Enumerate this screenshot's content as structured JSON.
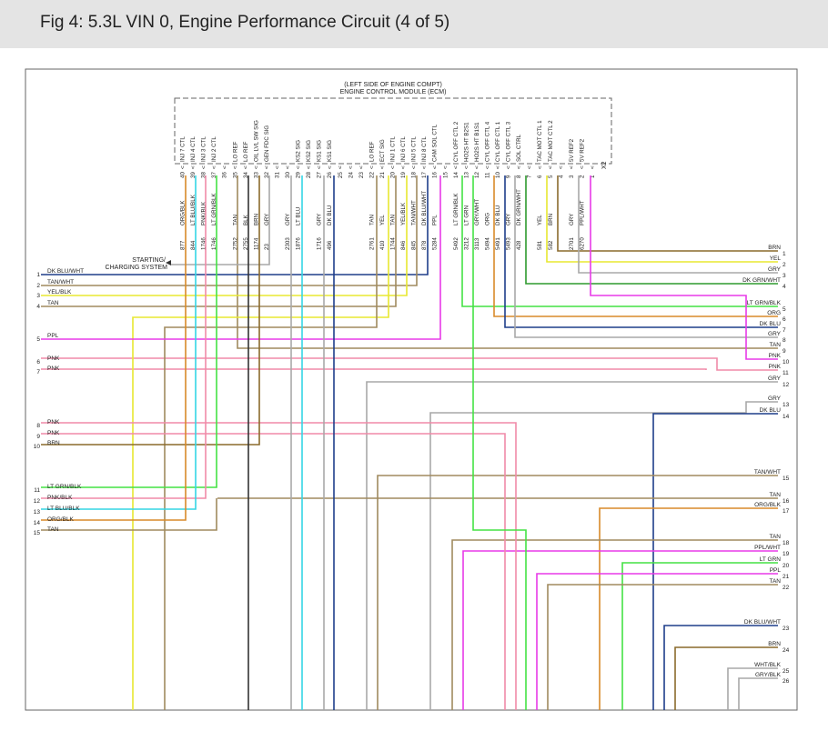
{
  "title": "Fig 4: 5.3L VIN 0, Engine Performance Circuit (4 of 5)",
  "ecm": {
    "line1": "(LEFT SIDE OF ENGINE COMPT)",
    "line2": "ENGINE CONTROL MODULE (ECM)",
    "connector": "X2",
    "pins": [
      {
        "pin": "40",
        "func": "INJ 7 CTL",
        "circuit": "877",
        "color": "ORG/BLK"
      },
      {
        "pin": "39",
        "func": "INJ 4 CTL",
        "circuit": "844",
        "color": "LT BLU/BLK"
      },
      {
        "pin": "38",
        "func": "INJ 3 CTL",
        "circuit": "1746",
        "color": "PNK/BLK"
      },
      {
        "pin": "37",
        "func": "INJ 2 CTL",
        "circuit": "1746",
        "color": "LT GRN/BLK"
      },
      {
        "pin": "36",
        "func": "",
        "circuit": "",
        "color": ""
      },
      {
        "pin": "35",
        "func": "LO REF",
        "circuit": "2752",
        "color": "TAN"
      },
      {
        "pin": "34",
        "func": "LO REF",
        "circuit": "2755",
        "color": "BLK"
      },
      {
        "pin": "33",
        "func": "OIL LVL SW SIG",
        "circuit": "1174",
        "color": "BRN"
      },
      {
        "pin": "32",
        "func": "GEN FDC SIG",
        "circuit": "23",
        "color": "GRY"
      },
      {
        "pin": "31",
        "func": "",
        "circuit": "",
        "color": ""
      },
      {
        "pin": "30",
        "func": "",
        "circuit": "2303",
        "color": "GRY"
      },
      {
        "pin": "29",
        "func": "KS2 SIG",
        "circuit": "1876",
        "color": "LT BLU"
      },
      {
        "pin": "28",
        "func": "KS2 SIG",
        "circuit": "",
        "color": ""
      },
      {
        "pin": "27",
        "func": "KS1 SIG",
        "circuit": "1716",
        "color": "GRY"
      },
      {
        "pin": "26",
        "func": "KS1 SIG",
        "circuit": "496",
        "color": "DK BLU"
      },
      {
        "pin": "25",
        "func": "",
        "circuit": "",
        "color": ""
      },
      {
        "pin": "24",
        "func": "",
        "circuit": "",
        "color": ""
      },
      {
        "pin": "23",
        "func": "",
        "circuit": "",
        "color": ""
      },
      {
        "pin": "22",
        "func": "LO REF",
        "circuit": "2761",
        "color": "TAN"
      },
      {
        "pin": "21",
        "func": "ECT SIG",
        "circuit": "410",
        "color": "YEL"
      },
      {
        "pin": "20",
        "func": "INJ 1 CTL",
        "circuit": "1744",
        "color": "TAN"
      },
      {
        "pin": "19",
        "func": "INJ 6 CTL",
        "circuit": "846",
        "color": "YEL/BLK"
      },
      {
        "pin": "18",
        "func": "INJ 5 CTL",
        "circuit": "845",
        "color": "TAN/WHT"
      },
      {
        "pin": "17",
        "func": "INJ 8 CTL",
        "circuit": "878",
        "color": "DK BLU/WHT"
      },
      {
        "pin": "16",
        "func": "CAM SOL CTL",
        "circuit": "5284",
        "color": "PPL"
      },
      {
        "pin": "15",
        "func": "",
        "circuit": "",
        "color": ""
      },
      {
        "pin": "14",
        "func": "CYL OFF CTL 2",
        "circuit": "5492",
        "color": "LT GRN/BLK"
      },
      {
        "pin": "13",
        "func": "HO2S HT B2S1",
        "circuit": "3212",
        "color": "LT GRN"
      },
      {
        "pin": "12",
        "func": "HO2S HT B1S1",
        "circuit": "3113",
        "color": "GRY/WHT"
      },
      {
        "pin": "11",
        "func": "CYL OFF CTL 4",
        "circuit": "5494",
        "color": "ORG"
      },
      {
        "pin": "10",
        "func": "CYL OFF CTL 1",
        "circuit": "5491",
        "color": "DK BLU"
      },
      {
        "pin": "9",
        "func": "CYL OFF CTL 3",
        "circuit": "5493",
        "color": "GRY"
      },
      {
        "pin": "8",
        "func": "SOL CTRL",
        "circuit": "428",
        "color": "DK GRN/WHT"
      },
      {
        "pin": "7",
        "func": "",
        "circuit": "",
        "color": ""
      },
      {
        "pin": "6",
        "func": "TAC MOT CTL 1",
        "circuit": "581",
        "color": "YEL"
      },
      {
        "pin": "5",
        "func": "TAC MOT CTL 2",
        "circuit": "582",
        "color": "BRN"
      },
      {
        "pin": "4",
        "func": "",
        "circuit": "",
        "color": ""
      },
      {
        "pin": "3",
        "func": "5V REF2",
        "circuit": "2701",
        "color": "GRY"
      },
      {
        "pin": "2",
        "func": "5V REF2",
        "circuit": "6270",
        "color": "PPL/WHT"
      },
      {
        "pin": "1",
        "func": "",
        "circuit": "",
        "color": ""
      }
    ]
  },
  "starting_label1": "STARTING/",
  "starting_label2": "CHARGING SYSTEM",
  "left_wires": [
    {
      "num": "1",
      "label": "DK BLU/WHT"
    },
    {
      "num": "2",
      "label": "TAN/WHT"
    },
    {
      "num": "3",
      "label": "YEL/BLK"
    },
    {
      "num": "4",
      "label": "TAN"
    },
    {
      "num": "5",
      "label": "PPL"
    },
    {
      "num": "6",
      "label": "PNK"
    },
    {
      "num": "7",
      "label": "PNK"
    },
    {
      "num": "8",
      "label": "PNK"
    },
    {
      "num": "9",
      "label": "PNK"
    },
    {
      "num": "10",
      "label": "BRN"
    },
    {
      "num": "11",
      "label": "LT GRN/BLK"
    },
    {
      "num": "12",
      "label": "PNK/BLK"
    },
    {
      "num": "13",
      "label": "LT BLU/BLK"
    },
    {
      "num": "14",
      "label": "ORG/BLK"
    },
    {
      "num": "15",
      "label": "TAN"
    }
  ],
  "right_wires": [
    {
      "num": "1",
      "label": "BRN"
    },
    {
      "num": "2",
      "label": "YEL"
    },
    {
      "num": "3",
      "label": "GRY"
    },
    {
      "num": "4",
      "label": "DK GRN/WHT"
    },
    {
      "num": "5",
      "label": "LT GRN/BLK"
    },
    {
      "num": "6",
      "label": "ORG"
    },
    {
      "num": "7",
      "label": "DK BLU"
    },
    {
      "num": "8",
      "label": "GRY"
    },
    {
      "num": "9",
      "label": "TAN"
    },
    {
      "num": "10",
      "label": "PNK"
    },
    {
      "num": "11",
      "label": "PNK"
    },
    {
      "num": "12",
      "label": "GRY"
    },
    {
      "num": "13",
      "label": "GRY"
    },
    {
      "num": "14",
      "label": "DK BLU"
    },
    {
      "num": "15",
      "label": "TAN/WHT"
    },
    {
      "num": "16",
      "label": "TAN"
    },
    {
      "num": "17",
      "label": "ORG/BLK"
    },
    {
      "num": "18",
      "label": "TAN"
    },
    {
      "num": "19",
      "label": "PPL/WHT"
    },
    {
      "num": "20",
      "label": "LT GRN"
    },
    {
      "num": "21",
      "label": "PPL"
    },
    {
      "num": "22",
      "label": "TAN"
    },
    {
      "num": "23",
      "label": "DK BLU/WHT"
    },
    {
      "num": "24",
      "label": "BRN"
    },
    {
      "num": "25",
      "label": "WHT/BLK"
    },
    {
      "num": "26",
      "label": "GRY/BLK"
    }
  ],
  "wire_colors": {
    "TAN": "#a08a5e",
    "BRN": "#8a6a2c",
    "YEL": "#e8e830",
    "GRY": "#a8a8a8",
    "DK_GRN": "#2e9a2e",
    "LT_GRN": "#44e244",
    "ORG": "#d98a2a",
    "DK_BLU": "#1e3e8a",
    "LT_BLU": "#34d6e4",
    "PNK": "#f08aa8",
    "PPL": "#e83ae8",
    "BLK": "#333333"
  }
}
